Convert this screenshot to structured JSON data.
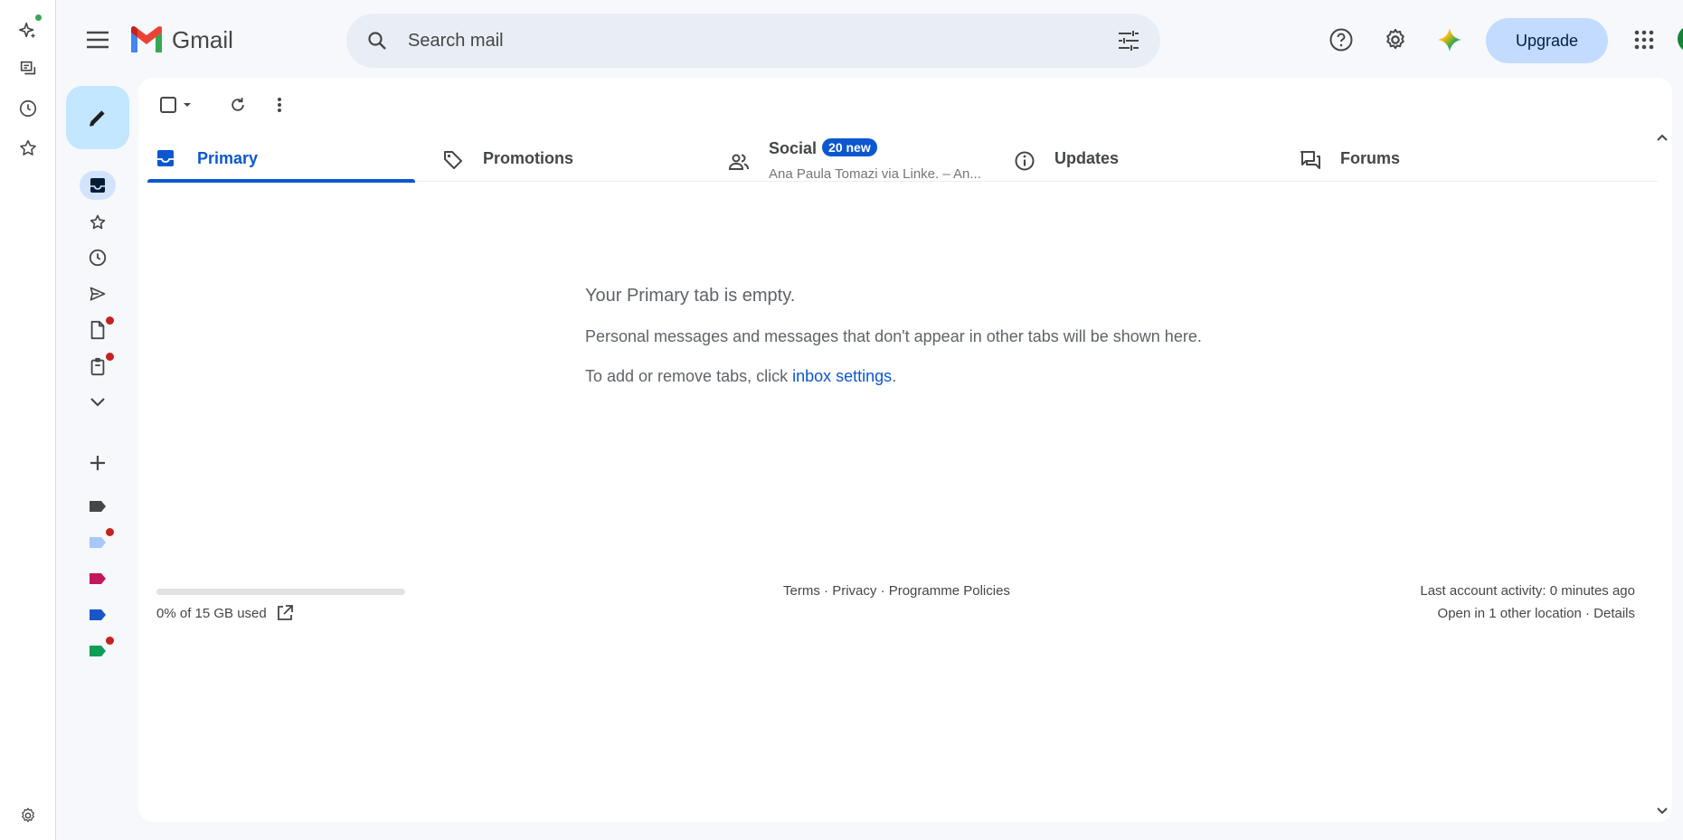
{
  "app": {
    "name": "Gmail"
  },
  "search": {
    "placeholder": "Search mail"
  },
  "header": {
    "upgrade_label": "Upgrade"
  },
  "tabs": [
    {
      "label": "Primary",
      "icon": "inbox-icon",
      "active": true
    },
    {
      "label": "Promotions",
      "icon": "tag-icon"
    },
    {
      "label": "Social",
      "icon": "people-icon",
      "badge": "20 new",
      "subtitle": "Ana Paula Tomazi via Linke. – An..."
    },
    {
      "label": "Updates",
      "icon": "info-icon"
    },
    {
      "label": "Forums",
      "icon": "forum-icon"
    }
  ],
  "empty_state": {
    "title": "Your Primary tab is empty.",
    "line1": "Personal messages and messages that don't appear in other tabs will be shown here.",
    "line2_prefix": "To add or remove tabs, click ",
    "line2_link": "inbox settings",
    "line2_suffix": "."
  },
  "storage": {
    "used_fraction": 0.0,
    "text": "0% of 15 GB used"
  },
  "footer": {
    "terms": "Terms",
    "privacy": "Privacy",
    "policies": "Programme Policies",
    "separator": " · "
  },
  "activity": {
    "last": "Last account activity: 0 minutes ago",
    "other_prefix": "Open in 1 other location · ",
    "details": "Details"
  },
  "colors": {
    "accent": "#0b57d0",
    "compose_bg": "#c2e7ff",
    "upgrade_bg": "#c2dbff",
    "notification_dot": "#c5221f",
    "label_dark": "#444746",
    "label_lightblue": "#a8c7fa",
    "label_red": "#c2185b",
    "label_blue": "#1a56c8",
    "label_green": "#0f9d58"
  }
}
